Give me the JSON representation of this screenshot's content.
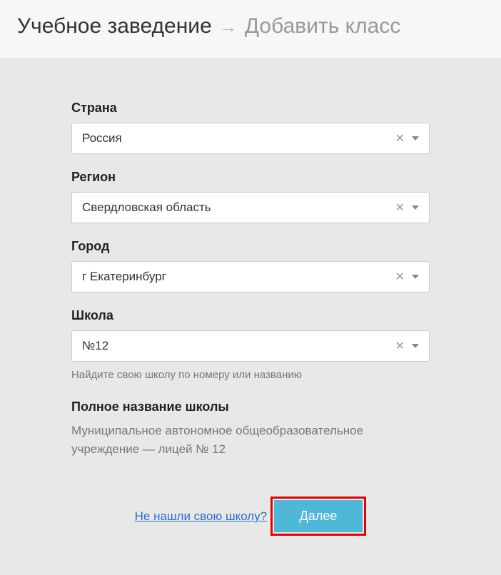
{
  "breadcrumb": {
    "root": "Учебное заведение",
    "current": "Добавить класс"
  },
  "fields": {
    "country": {
      "label": "Страна",
      "value": "Россия"
    },
    "region": {
      "label": "Регион",
      "value": "Свердловская область"
    },
    "city": {
      "label": "Город",
      "value": "г Екатеринбург"
    },
    "school": {
      "label": "Школа",
      "value": "№12",
      "hint": "Найдите свою школу по номеру или названию"
    }
  },
  "fullName": {
    "label": "Полное название школы",
    "value": "Муниципальное автономное общеобразовательное учреждение — лицей № 12"
  },
  "footer": {
    "notFoundLink": "Не нашли свою школу?",
    "nextButton": "Далее"
  }
}
